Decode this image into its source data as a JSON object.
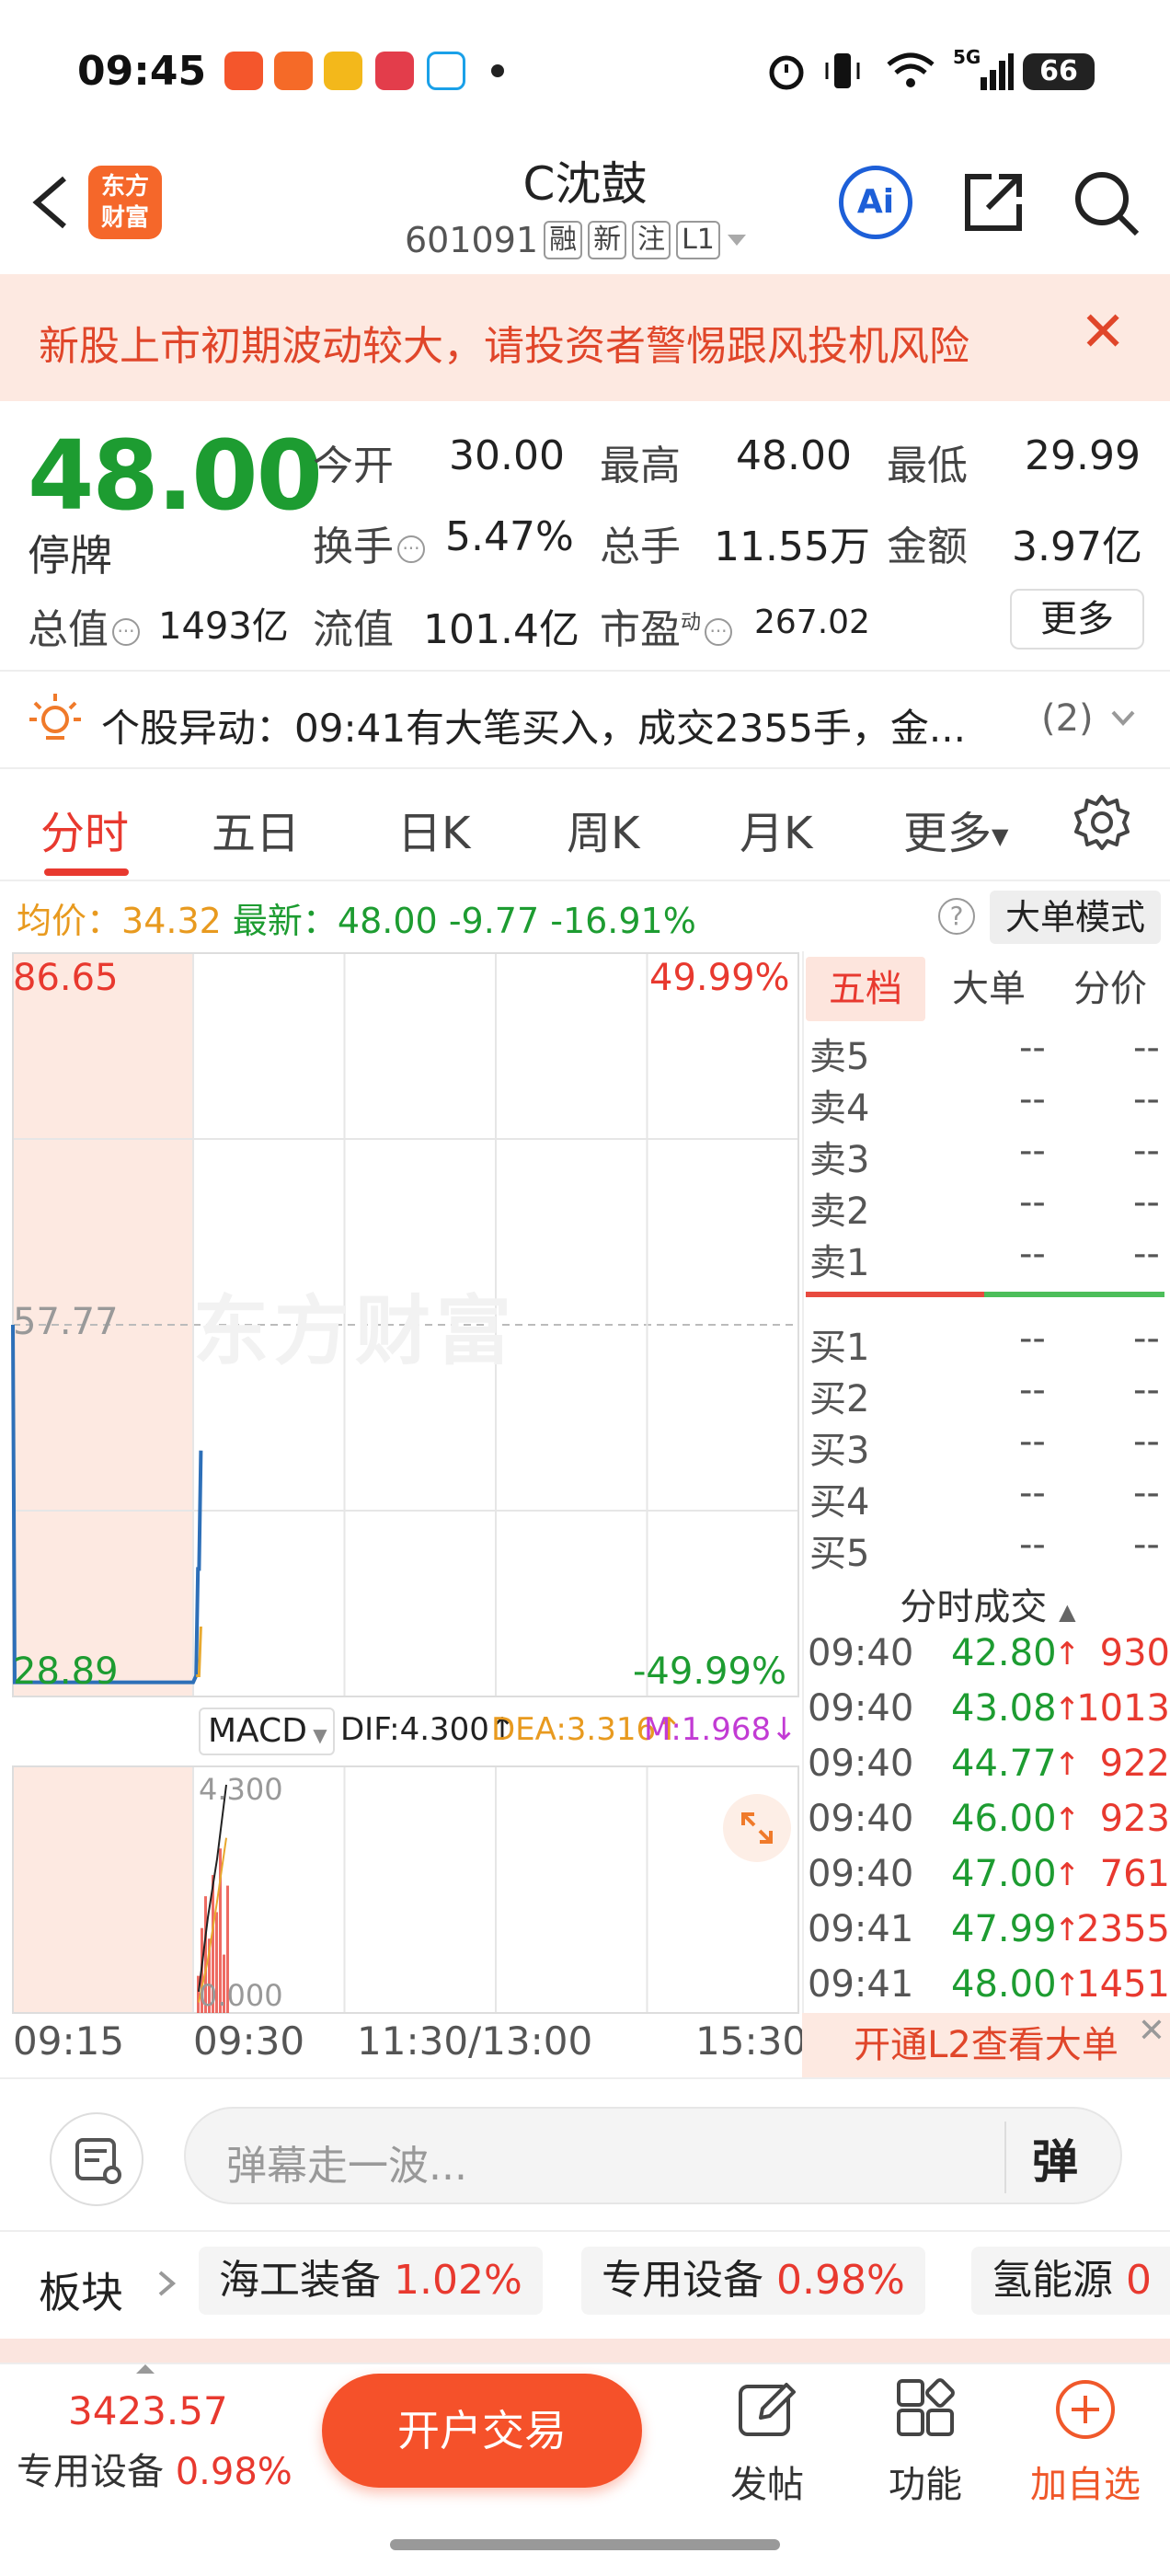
{
  "status_bar": {
    "time": "09:45",
    "signal_label": "5G",
    "battery": "66",
    "app_icon_colors": [
      "#f4562c",
      "#f56a28",
      "#f3b81b",
      "#e33d4b",
      "#1aa0e8"
    ]
  },
  "header": {
    "back_icon": "chevron-left-icon",
    "logo_text": "东方\n财富",
    "stock_name": "C沈鼓",
    "stock_code": "601091",
    "tags": [
      "融",
      "新",
      "注",
      "L1"
    ],
    "ai_label": "Ai"
  },
  "warning": {
    "text": "新股上市初期波动较大，请投资者警惕跟风投机风险",
    "close": "✕"
  },
  "quote": {
    "price": "48.00",
    "status": "停牌",
    "fields": [
      {
        "label": "今开",
        "value": "30.00",
        "color": "green"
      },
      {
        "label": "最高",
        "value": "48.00",
        "color": "green"
      },
      {
        "label": "最低",
        "value": "29.99",
        "color": "green"
      },
      {
        "label": "换手",
        "value": "5.47%",
        "color": "black"
      },
      {
        "label": "总手",
        "value": "11.55万",
        "color": "black"
      },
      {
        "label": "金额",
        "value": "3.97亿",
        "color": "black"
      },
      {
        "label": "总值",
        "value": "1493亿",
        "color": "black"
      },
      {
        "label": "流值",
        "value": "101.4亿",
        "color": "black"
      },
      {
        "label": "市盈",
        "value": "267.02",
        "color": "black",
        "sup": "动"
      }
    ],
    "more_label": "更多"
  },
  "alert": {
    "text": "个股异动：09:41有大笔买入，成交2355手，金...",
    "count": "(2)"
  },
  "tabs": [
    "分时",
    "五日",
    "日K",
    "周K",
    "月K",
    "更多"
  ],
  "info_line": {
    "avg_label": "均价：",
    "avg_value": "34.32",
    "latest_label": "最新：",
    "latest_value": "48.00",
    "change": "-9.77",
    "change_pct": "-16.91%",
    "mode_button": "大单模式",
    "help": "?"
  },
  "chart_data": {
    "type": "line",
    "title": "",
    "y_top": "86.65",
    "y_mid": "57.77",
    "y_bottom": "28.89",
    "pct_top": "49.99%",
    "pct_bottom": "-49.99%",
    "ylim": [
      28.89,
      86.65
    ],
    "watermark": "东方财富",
    "x_labels": [
      "09:15",
      "09:30",
      "11:30/13:00",
      "15:30"
    ],
    "series": [
      {
        "x": [
          "09:15",
          "09:15",
          "09:30",
          "09:31",
          "09:31",
          "09:32",
          "09:32"
        ],
        "values": [
          57.77,
          29.99,
          29.99,
          30.5,
          38.8,
          38.8,
          48.0
        ]
      },
      {
        "x": [
          "09:31",
          "09:32",
          "09:32"
        ],
        "values": [
          30.5,
          30.5,
          34.32
        ]
      }
    ],
    "colors": {
      "price_line": "#2d6fb8",
      "avg_line": "#e8a92e",
      "pre_market_bg": "#fde9e1",
      "grid": "#e6e6e6"
    }
  },
  "macd": {
    "dropdown": "MACD",
    "dif": "DIF:4.300↑",
    "dea": "DEA:3.316↑",
    "m": "M:1.968↓",
    "top_value": "4.300",
    "bottom_value": "0.000",
    "bars": [
      0.7,
      1.6,
      2.2,
      1.4,
      2.6,
      1.9,
      3.1,
      1.1,
      2.4
    ],
    "dif_line": [
      0.4,
      1.8,
      2.9,
      4.3
    ],
    "dea_line": [
      0.2,
      1.0,
      2.1,
      3.3
    ]
  },
  "order_book": {
    "tabs": [
      "五档",
      "大单",
      "分价"
    ],
    "sells": [
      {
        "label": "卖5",
        "price": "--",
        "vol": "--"
      },
      {
        "label": "卖4",
        "price": "--",
        "vol": "--"
      },
      {
        "label": "卖3",
        "price": "--",
        "vol": "--"
      },
      {
        "label": "卖2",
        "price": "--",
        "vol": "--"
      },
      {
        "label": "卖1",
        "price": "--",
        "vol": "--"
      }
    ],
    "buys": [
      {
        "label": "买1",
        "price": "--",
        "vol": "--"
      },
      {
        "label": "买2",
        "price": "--",
        "vol": "--"
      },
      {
        "label": "买3",
        "price": "--",
        "vol": "--"
      },
      {
        "label": "买4",
        "price": "--",
        "vol": "--"
      },
      {
        "label": "买5",
        "price": "--",
        "vol": "--"
      }
    ],
    "trades_title": "分时成交",
    "trades": [
      {
        "time": "09:40",
        "price": "42.80",
        "vol": "930"
      },
      {
        "time": "09:40",
        "price": "43.08",
        "vol": "1013"
      },
      {
        "time": "09:40",
        "price": "44.77",
        "vol": "922"
      },
      {
        "time": "09:40",
        "price": "46.00",
        "vol": "923"
      },
      {
        "time": "09:40",
        "price": "47.00",
        "vol": "761"
      },
      {
        "time": "09:41",
        "price": "47.99",
        "vol": "2355"
      },
      {
        "time": "09:41",
        "price": "48.00",
        "vol": "1451"
      }
    ],
    "l2_banner": "开通L2查看大单",
    "l2_close": "✕"
  },
  "danmaku": {
    "placeholder": "弹幕走一波...",
    "button": "弹"
  },
  "sector": {
    "label": "板块",
    "chips": [
      {
        "name": "海工装备",
        "pct": "1.02%"
      },
      {
        "name": "专用设备",
        "pct": "0.98%"
      },
      {
        "name": "氢能源",
        "pct": "0"
      }
    ]
  },
  "bottom_bar": {
    "index_value": "3423.57",
    "index_name": "专用设备",
    "index_pct": "0.98%",
    "trade_button": "开户交易",
    "actions": [
      "发帖",
      "功能",
      "加自选"
    ]
  }
}
